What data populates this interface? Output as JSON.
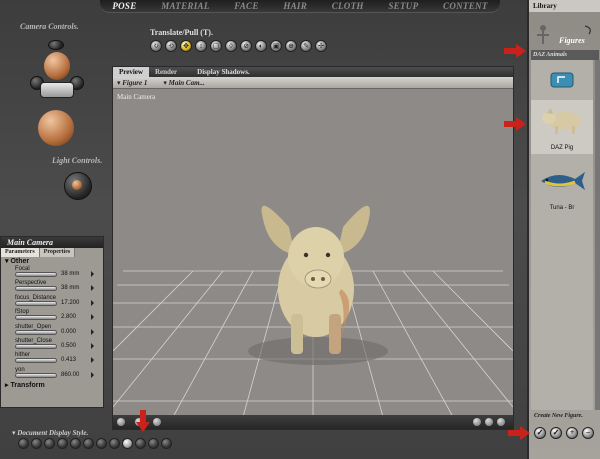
{
  "top_tabs": [
    "POSE",
    "MATERIAL",
    "FACE",
    "HAIR",
    "CLOTH",
    "SETUP",
    "CONTENT"
  ],
  "active_tab": "POSE",
  "camera_controls_label": "Camera Controls.",
  "light_controls_label": "Light Controls.",
  "translate_tool_label": "Translate/Pull (T).",
  "viewport": {
    "tabs": [
      "Preview",
      "Render"
    ],
    "active_tab": "Preview",
    "display_shadows": "Display Shadows.",
    "figure_menu": "Figure 1",
    "camera_menu": "Main Cam...",
    "camera_label": "Main Camera"
  },
  "parameters_panel": {
    "title": "Main Camera",
    "tabs": [
      "Parameters",
      "Properties"
    ],
    "active_tab": "Parameters",
    "group": "Other",
    "params": [
      {
        "name": "Focal",
        "value": "38 mm"
      },
      {
        "name": "Perspective",
        "value": "38 mm"
      },
      {
        "name": "focus_Distance",
        "value": "17.200"
      },
      {
        "name": "fStop",
        "value": "2.800"
      },
      {
        "name": "shutter_Open",
        "value": "0.000"
      },
      {
        "name": "shutter_Close",
        "value": "0.500"
      },
      {
        "name": "hither",
        "value": "0.413"
      },
      {
        "name": "yon",
        "value": "860.00"
      }
    ],
    "collapsed_group": "Transform"
  },
  "library": {
    "title": "Library",
    "category": "Figures",
    "subcategory": "DAZ Animals",
    "items": [
      {
        "name": "",
        "kind": "folder"
      },
      {
        "name": "DAZ Pig",
        "kind": "pig",
        "selected": true
      },
      {
        "name": "Tuna - Br",
        "kind": "fish",
        "selected": false
      }
    ],
    "create_label": "Create New Figure."
  },
  "display_style_label": "Document Display Style.",
  "display_style_count": 12,
  "display_style_selected_index": 8,
  "colors": {
    "arrow": "#c9221b",
    "viewport_bg": "#8d8a88",
    "active_tool": "#d8b62a"
  }
}
